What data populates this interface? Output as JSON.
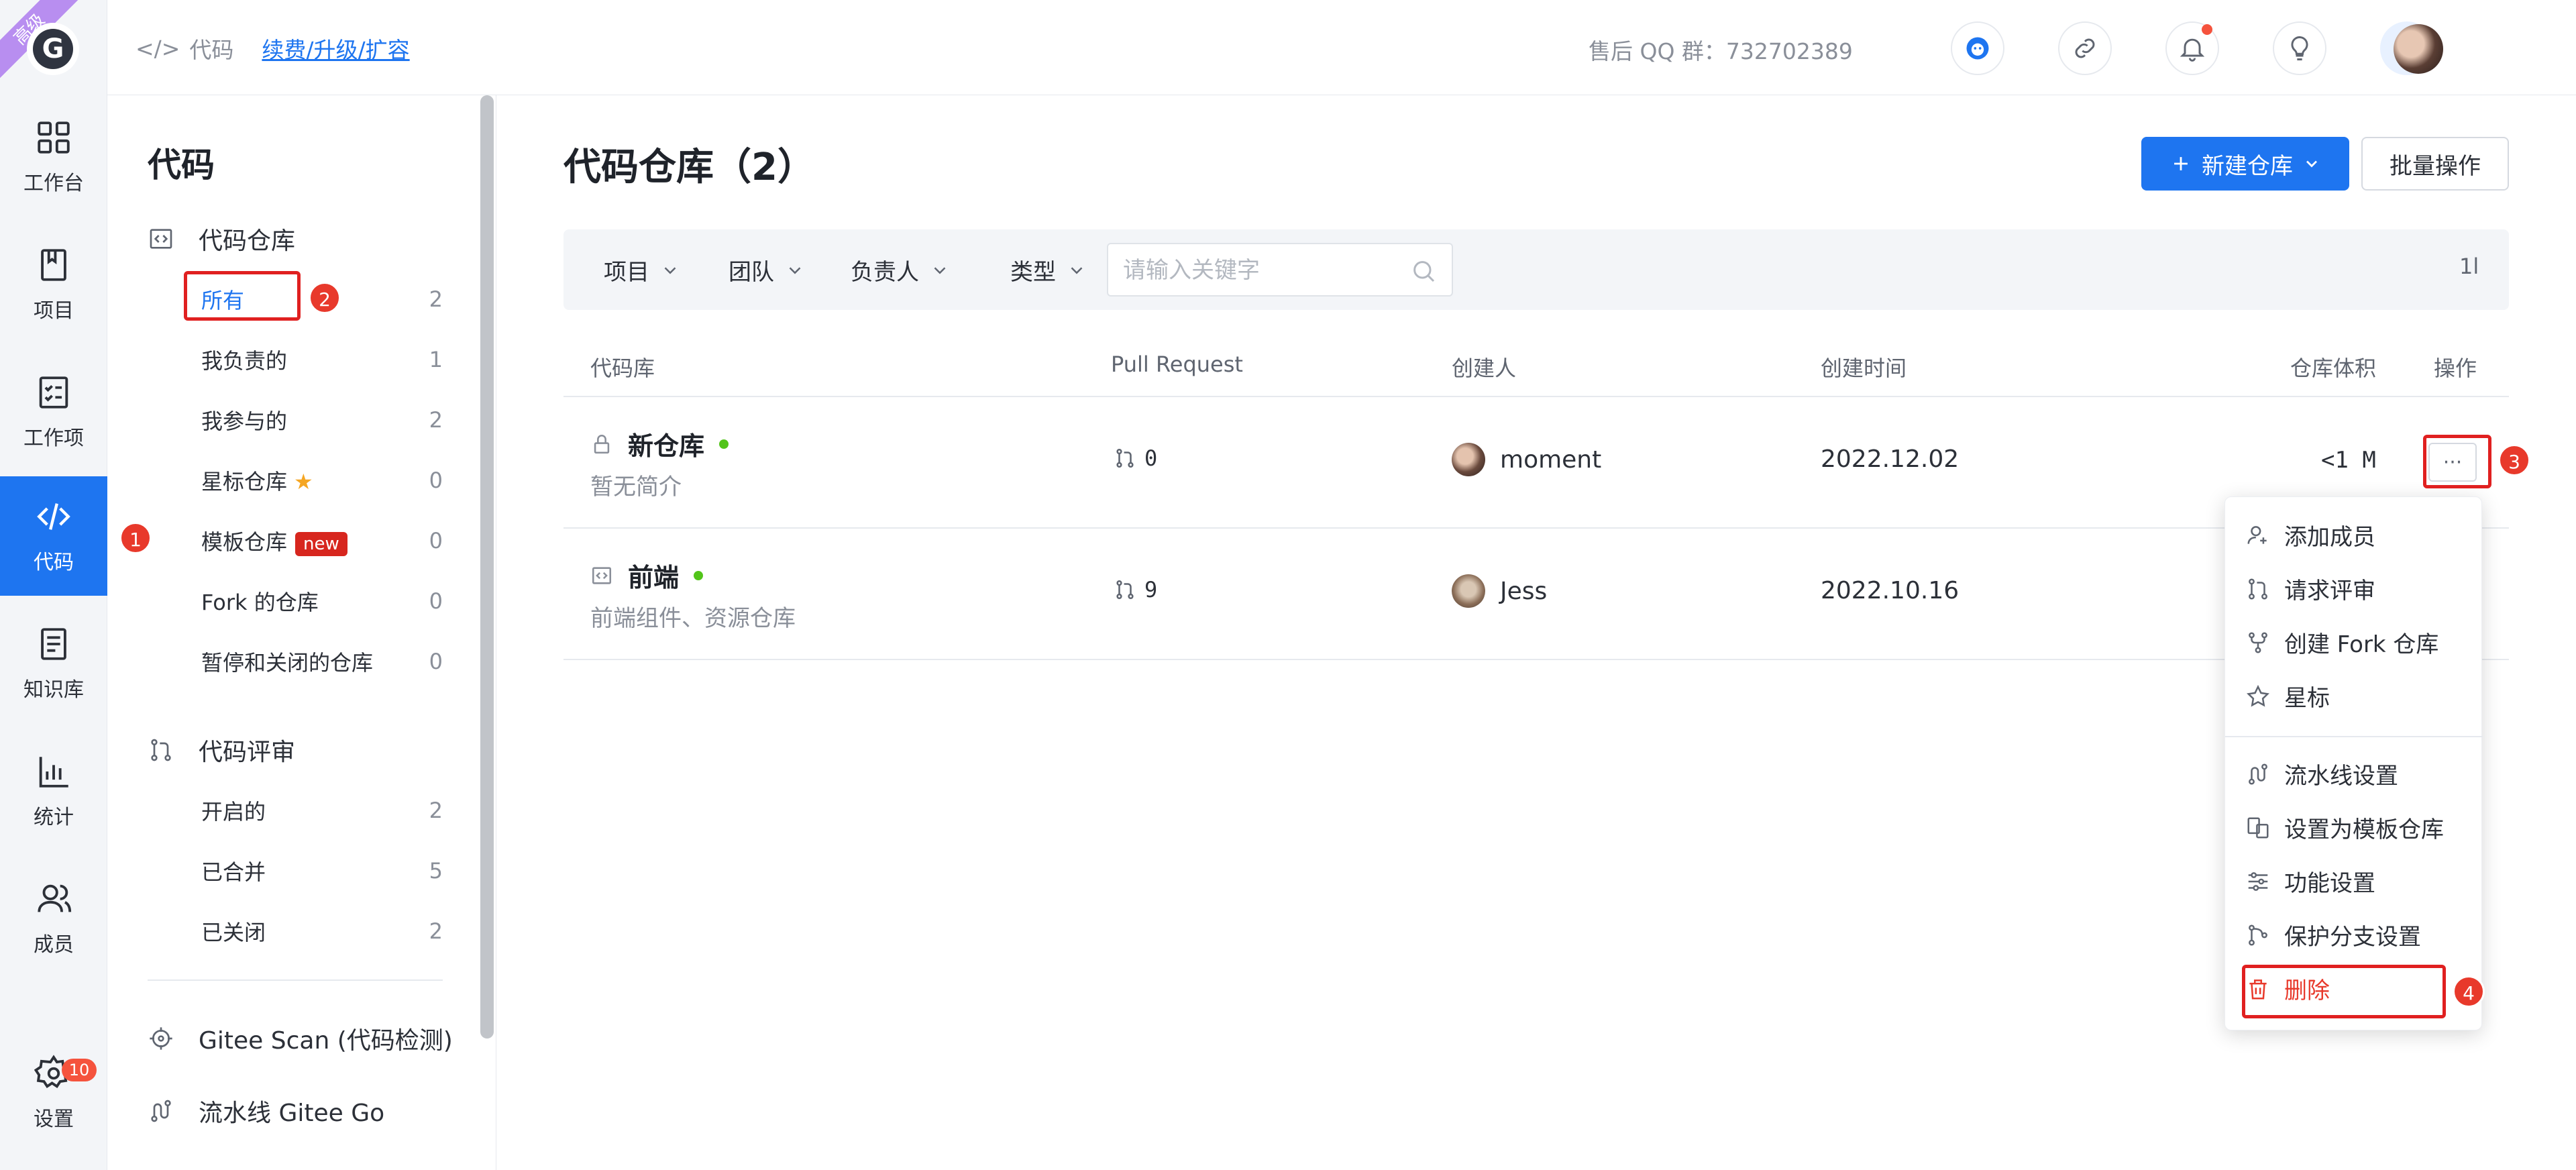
{
  "badge_ribbon": "高级",
  "rail": {
    "items": [
      {
        "label": "工作台",
        "icon": "dashboard-icon"
      },
      {
        "label": "项目",
        "icon": "book-icon"
      },
      {
        "label": "工作项",
        "icon": "checklist-icon"
      },
      {
        "label": "代码",
        "icon": "code-icon"
      },
      {
        "label": "知识库",
        "icon": "document-icon"
      },
      {
        "label": "统计",
        "icon": "bar-chart-icon"
      },
      {
        "label": "成员",
        "icon": "members-icon"
      },
      {
        "label": "设置",
        "icon": "gear-icon"
      }
    ],
    "active_index": 3,
    "settings_badge": "10"
  },
  "topbar": {
    "crumb_label": "代码",
    "crumb_link": "续费/升级/扩容",
    "qq_group": "售后 QQ 群：732702389"
  },
  "sidebar": {
    "title": "代码",
    "repo_group": "代码仓库",
    "repo_items": [
      {
        "label": "所有",
        "count": "2"
      },
      {
        "label": "我负责的",
        "count": "1"
      },
      {
        "label": "我参与的",
        "count": "2"
      },
      {
        "label": "星标仓库",
        "count": "0"
      },
      {
        "label": "模板仓库",
        "count": "0",
        "badge": "new"
      },
      {
        "label": "Fork 的仓库",
        "count": "0"
      },
      {
        "label": "暂停和关闭的仓库",
        "count": "0"
      }
    ],
    "review_group": "代码评审",
    "review_items": [
      {
        "label": "开启的",
        "count": "2"
      },
      {
        "label": "已合并",
        "count": "5"
      },
      {
        "label": "已关闭",
        "count": "2"
      }
    ],
    "extra_items": [
      {
        "label": "Gitee Scan (代码检测)"
      },
      {
        "label": "流水线 Gitee Go"
      }
    ]
  },
  "main": {
    "title": "代码仓库（2）",
    "new_button": "新建仓库",
    "batch_button": "批量操作",
    "filters": [
      "项目",
      "团队",
      "负责人",
      "类型"
    ],
    "search_placeholder": "请输入关键字",
    "sort_label": "1l",
    "columns": [
      "代码库",
      "Pull Request",
      "创建人",
      "创建时间",
      "仓库体积",
      "操作"
    ],
    "rows": [
      {
        "name": "新仓库",
        "desc": "暂无简介",
        "pr": "0",
        "creator": "moment",
        "created": "2022.12.02",
        "size": "<1 M"
      },
      {
        "name": "前端",
        "desc": "前端组件、资源仓库",
        "pr": "9",
        "creator": "Jess",
        "created": "2022.10.16",
        "size": ""
      }
    ],
    "more_label": "···"
  },
  "menu": {
    "items": [
      "添加成员",
      "请求评审",
      "创建 Fork 仓库",
      "星标",
      "流水线设置",
      "设置为模板仓库",
      "功能设置",
      "保护分支设置",
      "删除"
    ]
  },
  "annotations": [
    "1",
    "2",
    "3",
    "4"
  ],
  "colors": {
    "accent": "#1e75f0",
    "danger": "#e8392b",
    "highlight": "#e02020",
    "ok": "#52c41a"
  }
}
